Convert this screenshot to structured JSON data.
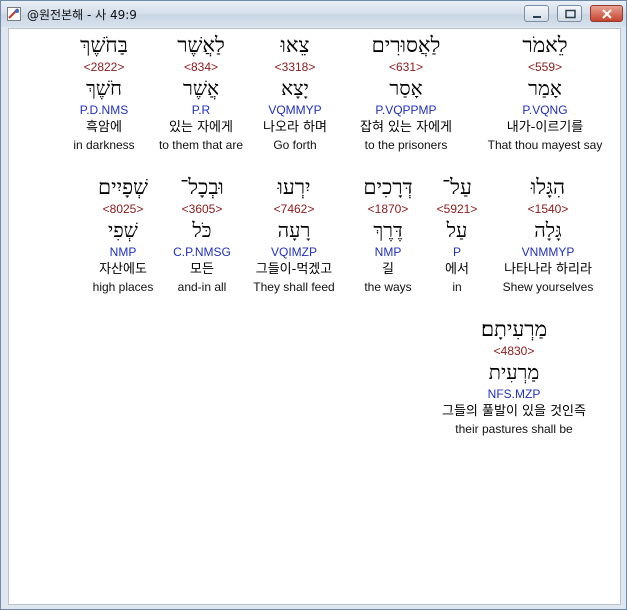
{
  "window": {
    "title": "@원전본해 - 사 49:9",
    "colors": {
      "frame": "#dfe6ee",
      "strong": "#8b1a1a",
      "parse": "#2030c0"
    }
  },
  "words": [
    {
      "heb": "לֵאמֹר",
      "strong": "<559>",
      "lemma": "אָמַר",
      "parse": "P.VQNG",
      "kor": "내가-이르기를",
      "eng": "That thou mayest say"
    },
    {
      "heb": "לַאֲסוּרִים",
      "strong": "<631>",
      "lemma": "אָסַר",
      "parse": "P.VQPPMP",
      "kor": "잡혀 있는 자에게",
      "eng": "to the prisoners"
    },
    {
      "heb": "צֵאוּ",
      "strong": "<3318>",
      "lemma": "יָצָא",
      "parse": "VQMMYP",
      "kor": "나오라 하며",
      "eng": "Go forth"
    },
    {
      "heb": "לַאֲשֶׁר",
      "strong": "<834>",
      "lemma": "אֲשֶׁר",
      "parse": "P.R",
      "kor": "있는 자에게",
      "eng": "to them that are"
    },
    {
      "heb": "בַּחֹשֶׁךְ",
      "strong": "<2822>",
      "lemma": "חֹשֶׁךְ",
      "parse": "P.D.NMS",
      "kor": "흑암에",
      "eng": "in darkness"
    },
    {
      "heb": "הִגָּלוּ",
      "strong": "<1540>",
      "lemma": "גָּלָה",
      "parse": "VNMMYP",
      "kor": "나타나라 하리라",
      "eng": "Shew yourselves"
    },
    {
      "heb": "עַל־",
      "strong": "<5921>",
      "lemma": "עַל",
      "parse": "P",
      "kor": "에서",
      "eng": "in"
    },
    {
      "heb": "דְּרָכִים",
      "strong": "<1870>",
      "lemma": "דֶּרֶךְ",
      "parse": "NMP",
      "kor": "길",
      "eng": "the ways"
    },
    {
      "heb": "יִרְעוּ",
      "strong": "<7462>",
      "lemma": "רָעָה",
      "parse": "VQIMZP",
      "kor": "그들이-먹겠고",
      "eng": "They shall feed"
    },
    {
      "heb": "וּבְכָל־",
      "strong": "<3605>",
      "lemma": "כֹּל",
      "parse": "C.P.NMSG",
      "kor": "모든",
      "eng": "and-in all"
    },
    {
      "heb": "שְׁפָיִים",
      "strong": "<8025>",
      "lemma": "שְׁפִי",
      "parse": "NMP",
      "kor": "자산에도",
      "eng": "high places"
    },
    {
      "heb": "מַרְעִיתָם׃",
      "strong": "<4830>",
      "lemma": "מַרְעִית",
      "parse": "NFS.MZP",
      "kor": "그들의 풀발이 있을 것인즉",
      "eng": "their pastures shall be"
    }
  ]
}
